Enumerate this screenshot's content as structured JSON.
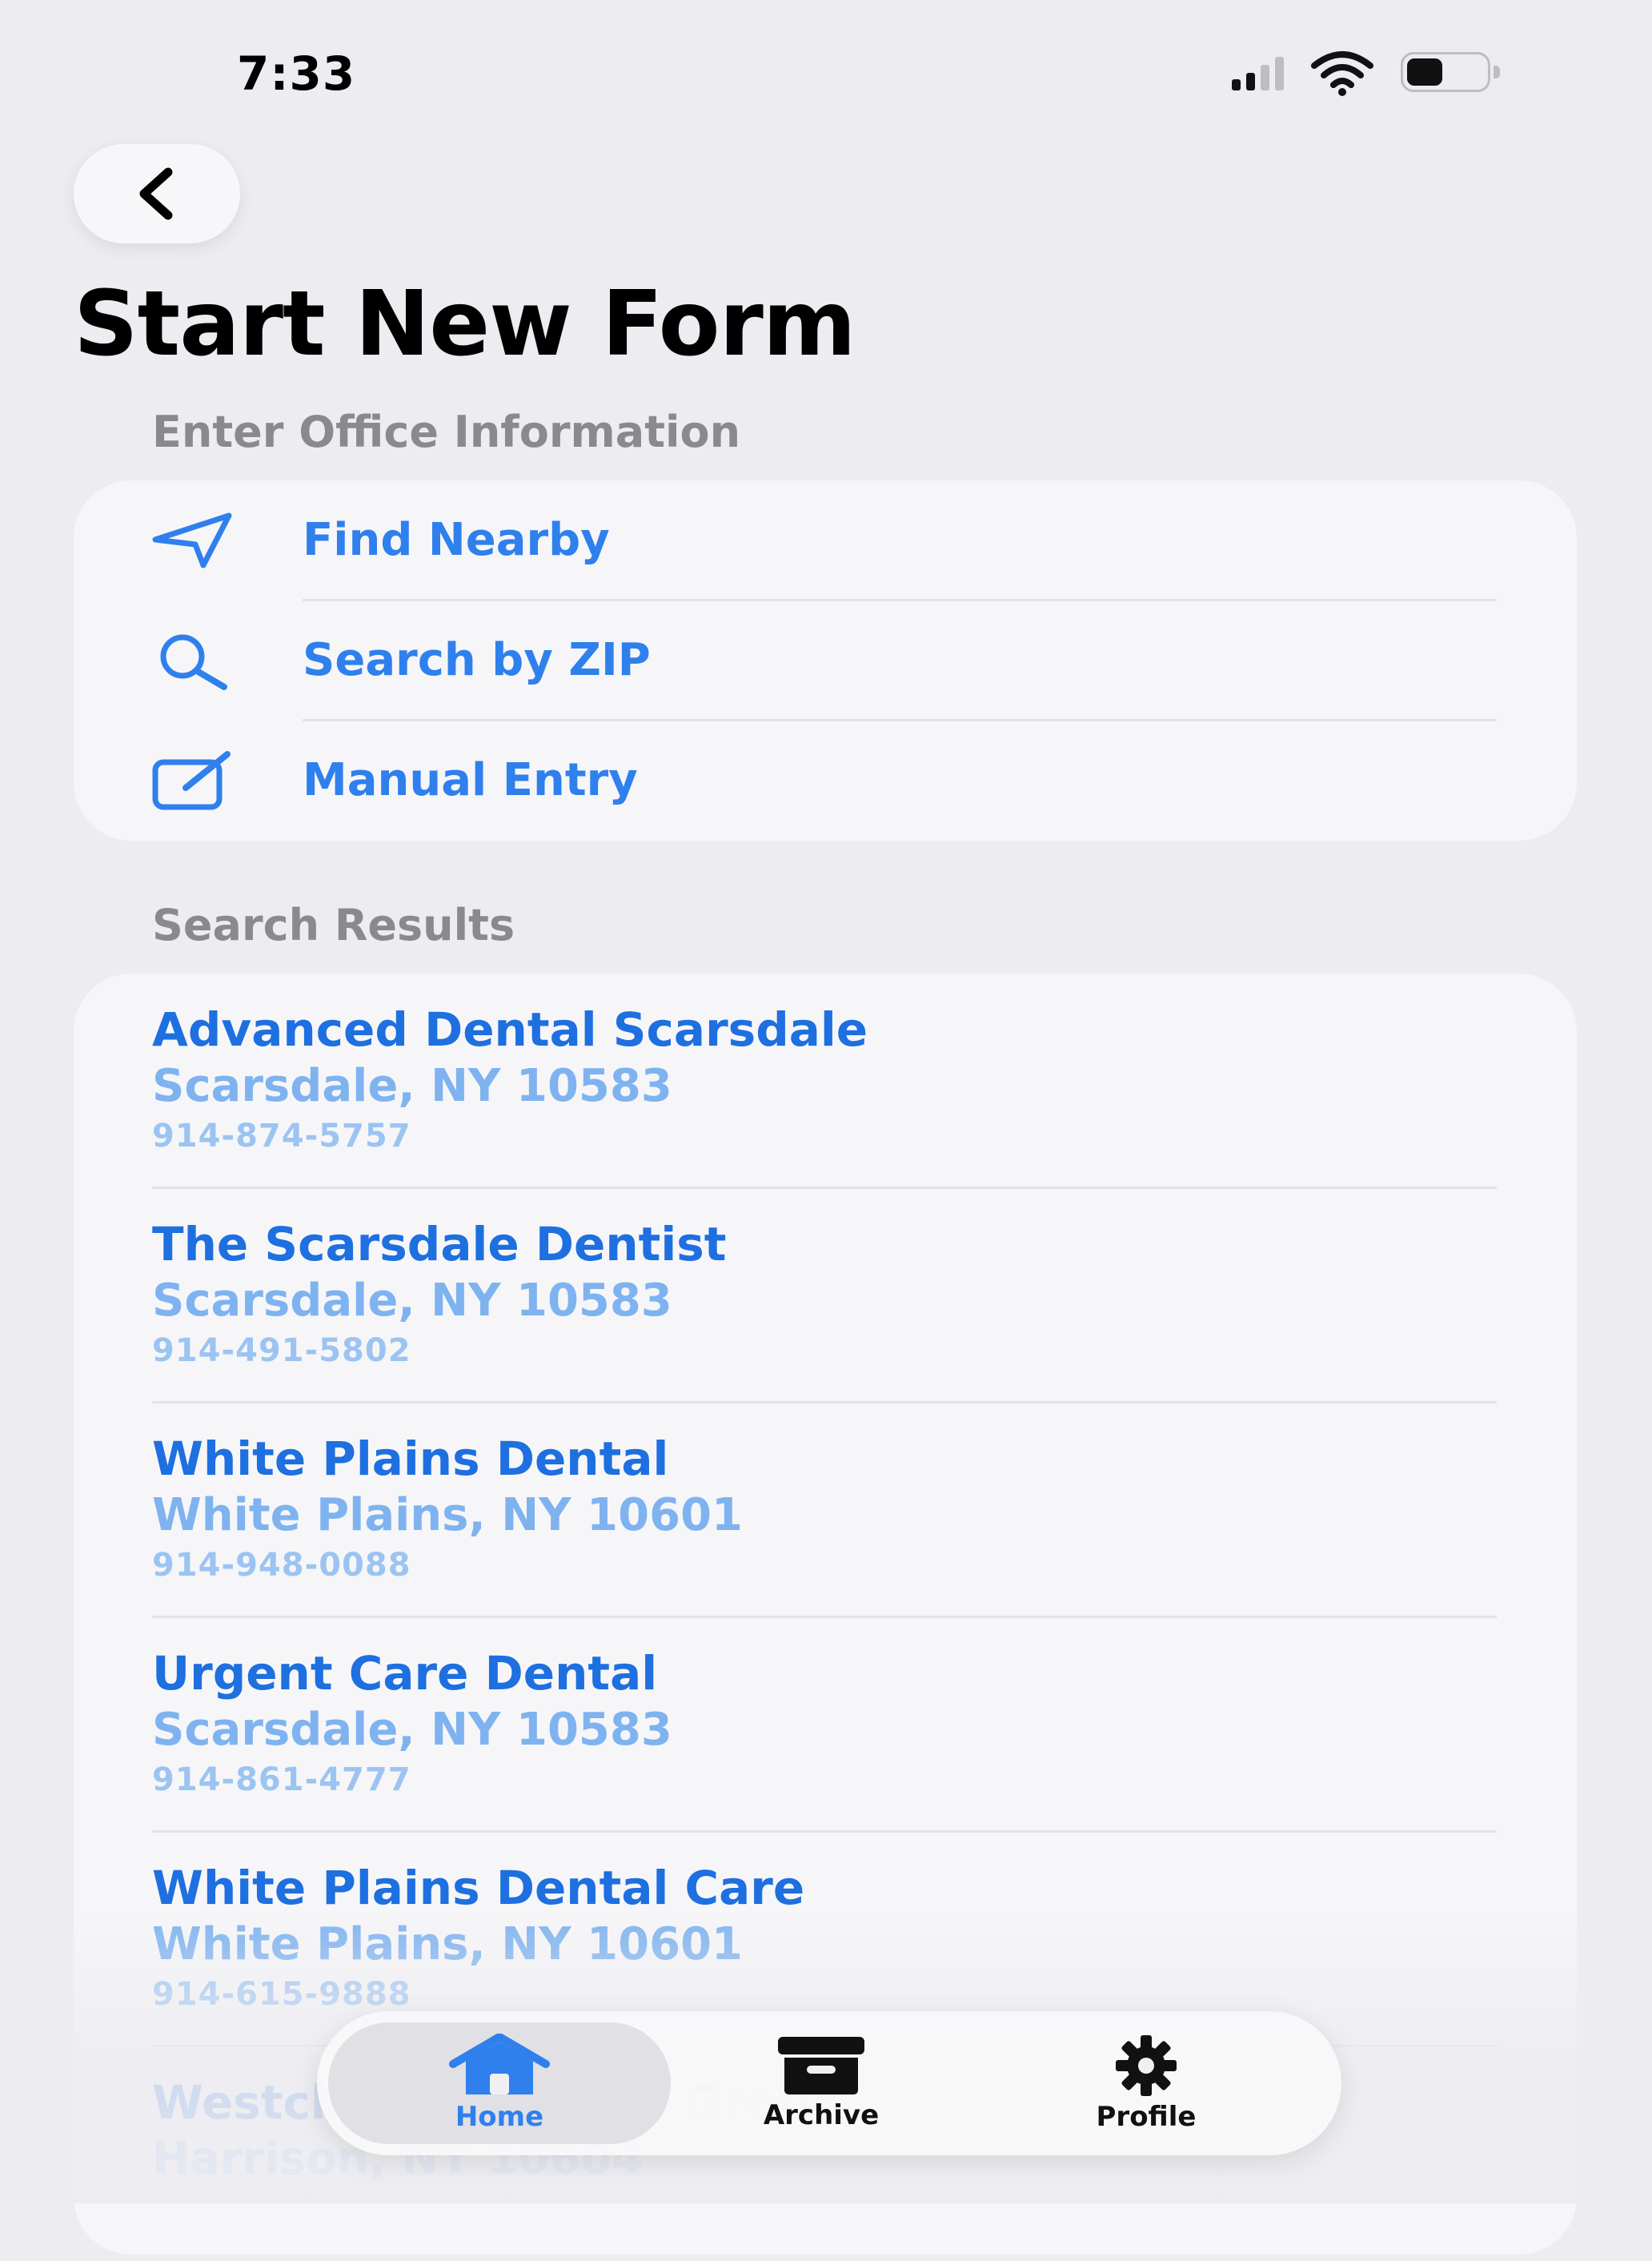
{
  "status_bar": {
    "time": "7:33"
  },
  "header": {
    "title": "Start New Form"
  },
  "office_info": {
    "section_title": "Enter Office Information",
    "options": [
      {
        "label": "Find Nearby",
        "icon": "location-arrow-icon"
      },
      {
        "label": "Search by ZIP",
        "icon": "search-icon"
      },
      {
        "label": "Manual Entry",
        "icon": "edit-icon"
      }
    ]
  },
  "search_results": {
    "section_title": "Search Results",
    "items": [
      {
        "name": "Advanced Dental Scarsdale",
        "city": "Scarsdale, NY 10583",
        "phone": "914-874-5757"
      },
      {
        "name": "The Scarsdale Dentist",
        "city": "Scarsdale, NY 10583",
        "phone": "914-491-5802"
      },
      {
        "name": "White Plains Dental",
        "city": "White Plains, NY 10601",
        "phone": "914-948-0088"
      },
      {
        "name": "Urgent Care Dental",
        "city": "Scarsdale, NY 10583",
        "phone": "914-861-4777"
      },
      {
        "name": "White Plains Dental Care",
        "city": "White Plains, NY 10601",
        "phone": "914-615-9888"
      },
      {
        "name": "Westchester Dental Group",
        "city": "Harrison, NY 10604",
        "phone": ""
      }
    ]
  },
  "tab_bar": {
    "tabs": [
      {
        "label": "Home",
        "icon": "house-icon",
        "selected": true
      },
      {
        "label": "Archive",
        "icon": "archive-box-icon",
        "selected": false
      },
      {
        "label": "Profile",
        "icon": "gear-icon",
        "selected": false
      }
    ]
  },
  "colors": {
    "accent": "#2F80ED",
    "background": "#ECECF1",
    "card": "#F6F6F8"
  }
}
